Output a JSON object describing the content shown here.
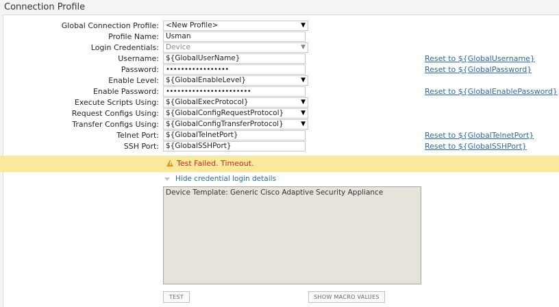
{
  "page_title": "Connection Profile",
  "form": {
    "global_connection_profile": {
      "label": "Global Connection Profile:",
      "value": "<New Profile>"
    },
    "profile_name": {
      "label": "Profile Name:",
      "value": "Usman"
    },
    "login_credentials": {
      "label": "Login Credentials:",
      "value": "Device"
    },
    "username": {
      "label": "Username:",
      "value": "${GlobalUserName}",
      "reset_link": "Reset to ${GlobalUsername}"
    },
    "password": {
      "label": "Password:",
      "value": "•••••••••••••••••",
      "reset_link": "Reset to ${GlobalPassword}"
    },
    "enable_level": {
      "label": "Enable Level:",
      "value": "${GlobalEnableLevel}"
    },
    "enable_password": {
      "label": "Enable Password:",
      "value": "•••••••••••••••••••••••",
      "reset_link": "Reset to ${GlobalEnablePassword}"
    },
    "execute_scripts": {
      "label": "Execute Scripts Using:",
      "value": "${GlobalExecProtocol}"
    },
    "request_configs": {
      "label": "Request Configs Using:",
      "value": "${GlobalConfigRequestProtocol}"
    },
    "transfer_configs": {
      "label": "Transfer Configs Using:",
      "value": "${GlobalConfigTransferProtocol}"
    },
    "telnet_port": {
      "label": "Telnet Port:",
      "value": "${GlobalTelnetPort}",
      "reset_link": "Reset to ${GlobalTelnetPort}"
    },
    "ssh_port": {
      "label": "SSH Port:",
      "value": "${GlobalSSHPort}",
      "reset_link": "Reset to ${GlobalSSHPort}"
    }
  },
  "alert": {
    "icon": "warning-icon",
    "message": "Test Failed. Timeout.",
    "background": "#fbe99b",
    "text_color": "#c62828"
  },
  "details_toggle": "Hide credential login details",
  "details_text": "Device Template: Generic Cisco Adaptive Security Appliance",
  "buttons": {
    "test": "TEST",
    "show_macro": "SHOW MACRO VALUES"
  },
  "colors": {
    "link": "#2a6aa0",
    "details_bg": "#e6e4da"
  }
}
